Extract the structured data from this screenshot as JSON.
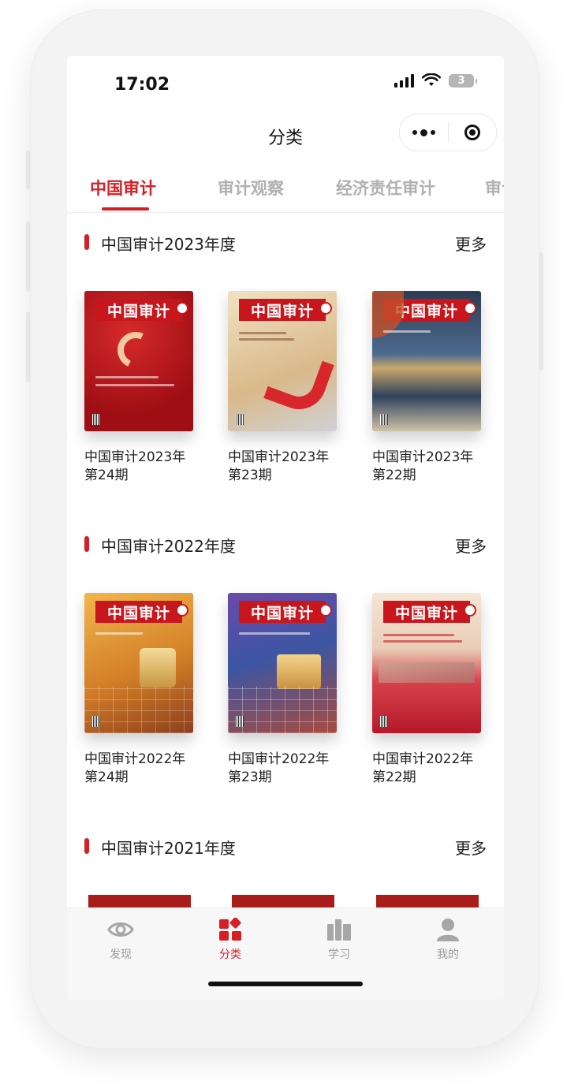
{
  "status_bar": {
    "time": "17:02",
    "battery": "3"
  },
  "nav": {
    "title": "分类"
  },
  "tabs": [
    {
      "label": "中国审计",
      "active": true
    },
    {
      "label": "审计观察",
      "active": false
    },
    {
      "label": "经济责任审计",
      "active": false
    },
    {
      "label": "审计",
      "active": false
    }
  ],
  "sections": [
    {
      "title": "中国审计2023年度",
      "more": "更多",
      "books": [
        {
          "title": "中国审计2023年\n第24期",
          "cover_color": "#b5141b",
          "mast": "中国审计"
        },
        {
          "title": "中国审计2023年\n第23期",
          "cover_color": "#e7cfa9",
          "mast": "中国审计"
        },
        {
          "title": "中国审计2023年\n第22期",
          "cover_color": "#3b4f6b",
          "mast": "中国审计"
        }
      ]
    },
    {
      "title": "中国审计2022年度",
      "more": "更多",
      "books": [
        {
          "title": "中国审计2022年\n第24期",
          "cover_color": "#d8902f",
          "mast": "中国审计"
        },
        {
          "title": "中国审计2022年\n第23期",
          "cover_color": "#4f4f9e",
          "mast": "中国审计"
        },
        {
          "title": "中国审计2022年\n第22期",
          "cover_color": "#c83a43",
          "mast": "中国审计"
        }
      ]
    },
    {
      "title": "中国审计2021年度",
      "more": "更多"
    }
  ],
  "tabbar": [
    {
      "label": "发现",
      "icon": "eye-icon",
      "active": false
    },
    {
      "label": "分类",
      "icon": "category-icon",
      "active": true
    },
    {
      "label": "学习",
      "icon": "books-icon",
      "active": false
    },
    {
      "label": "我的",
      "icon": "user-icon",
      "active": false
    }
  ],
  "colors": {
    "accent": "#d51f25",
    "muted": "#b0b0b0",
    "text": "#222222"
  }
}
